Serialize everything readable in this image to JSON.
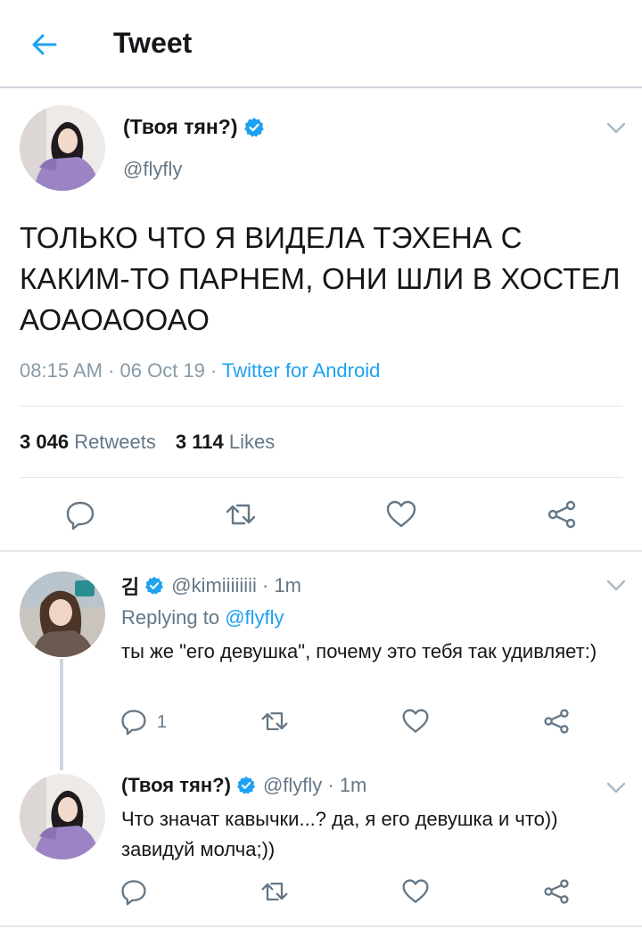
{
  "header": {
    "title": "Tweet",
    "back_icon": "arrow-left-icon"
  },
  "colors": {
    "accent": "#1da1f2",
    "text": "#14171a",
    "muted": "#657786",
    "verified": "#1da1f2"
  },
  "main_tweet": {
    "name": "(Твоя тян?)",
    "handle": "@flyfly",
    "text": "ТОЛЬКО ЧТО Я ВИДЕЛА ТЭХЕНА С КАКИМ-ТО ПАРНЕМ, ОНИ ШЛИ В ХОСТЕЛ АОАОАООАО",
    "time": "08:15 AM · 06 Oct 19 · ",
    "app": "Twitter for Android",
    "retweets_count": "3 046",
    "retweets_label": "Retweets",
    "likes_count": "3 114",
    "likes_label": "Likes"
  },
  "replies": [
    {
      "name": "김",
      "handle": "@kimiiiiiiii · 1m",
      "replying_prefix": "Replying to ",
      "replying_to": "@flyfly",
      "text": "ты же \"его девушка\",  почему это тебя так удивляет:)",
      "reply_count": "1"
    },
    {
      "name": "(Твоя тян?)",
      "handle": "@flyfly · 1m",
      "text": "Что значат кавычки...? да, я его девушка и что)) завидуй молча;))"
    }
  ]
}
